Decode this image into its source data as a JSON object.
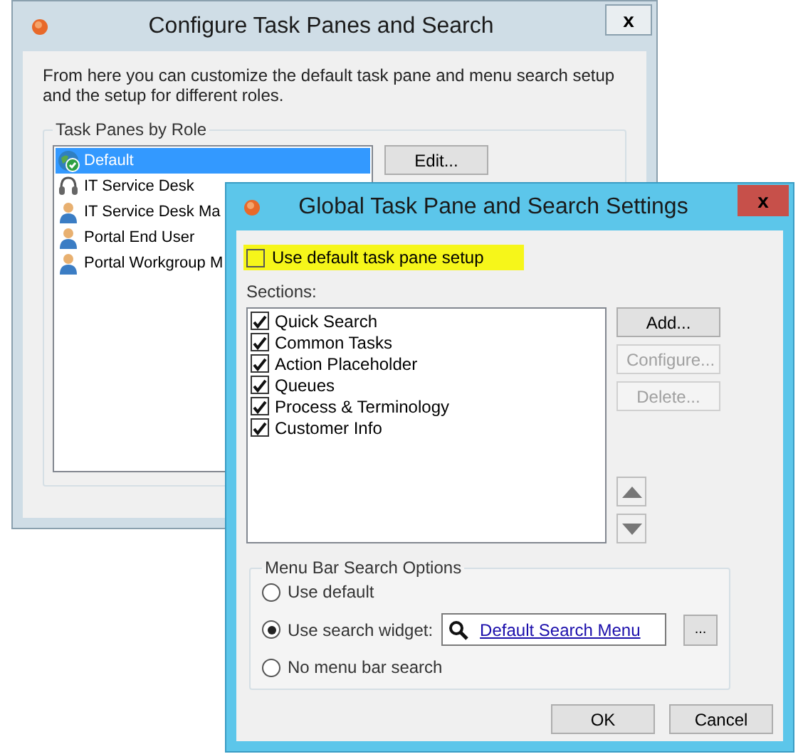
{
  "back_window": {
    "title": "Configure Task Panes and Search",
    "close": "x",
    "description": "From here you can customize the default task pane and menu search setup and the setup for different roles.",
    "group_title": "Task Panes by Role",
    "roles": [
      {
        "label": "Default",
        "kind": "globe",
        "selected": true
      },
      {
        "label": "IT Service Desk",
        "kind": "headset",
        "selected": false
      },
      {
        "label": "IT Service Desk Ma",
        "kind": "person",
        "selected": false
      },
      {
        "label": "Portal End User",
        "kind": "person",
        "selected": false
      },
      {
        "label": "Portal Workgroup M",
        "kind": "person",
        "selected": false
      }
    ],
    "buttons": [
      "Edit..."
    ]
  },
  "front_window": {
    "title": "Global Task Pane and Search Settings",
    "close": "x",
    "use_default": {
      "label": "Use default task pane setup",
      "checked": false,
      "highlighted": true
    },
    "sections_label": "Sections:",
    "sections": [
      {
        "label": "Quick Search",
        "checked": true
      },
      {
        "label": "Common Tasks",
        "checked": true
      },
      {
        "label": "Action Placeholder",
        "checked": true
      },
      {
        "label": "Queues",
        "checked": true
      },
      {
        "label": "Process & Terminology",
        "checked": true
      },
      {
        "label": "Customer Info",
        "checked": true
      }
    ],
    "buttons": [
      {
        "label": "Add...",
        "disabled": false
      },
      {
        "label": "Configure...",
        "disabled": true
      },
      {
        "label": "Delete...",
        "disabled": true
      }
    ],
    "search_options": {
      "title": "Menu Bar Search Options",
      "options": [
        {
          "label": "Use default",
          "selected": false
        },
        {
          "label": "Use search widget:",
          "selected": true
        },
        {
          "label": "No menu bar search",
          "selected": false
        }
      ],
      "widget_link": "Default Search Menu",
      "browse": "..."
    },
    "dialog_buttons": [
      "OK",
      "Cancel"
    ]
  }
}
